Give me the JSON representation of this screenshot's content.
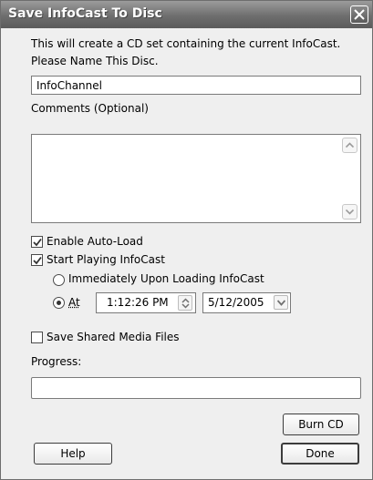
{
  "window": {
    "title": "Save InfoCast To Disc"
  },
  "intro": {
    "line1": "This will create a CD set containing the current InfoCast.",
    "line2": "Please Name This Disc."
  },
  "disc_name": {
    "value": "InfoChannel"
  },
  "comments": {
    "label": "Comments (Optional)",
    "value": ""
  },
  "enable_autoload": {
    "label": "Enable Auto-Load",
    "checked": true
  },
  "start_playing": {
    "label": "Start Playing InfoCast",
    "checked": true
  },
  "play_mode": {
    "options": [
      "Immediately Upon Loading InfoCast",
      "At"
    ],
    "selected": "At"
  },
  "time_value": "1:12:26 PM",
  "date_value": "5/12/2005",
  "save_shared": {
    "label": "Save Shared Media Files",
    "checked": false
  },
  "progress": {
    "label": "Progress:",
    "value": 0
  },
  "buttons": {
    "burn": "Burn CD",
    "help": "Help",
    "done": "Done"
  },
  "icons": {
    "close": "close-icon",
    "check": "checkmark-icon",
    "up": "scroll-up-arrow-icon",
    "down": "scroll-down-arrow-icon",
    "spin": "spin-arrows-icon",
    "dropdown": "chevron-down-icon"
  }
}
